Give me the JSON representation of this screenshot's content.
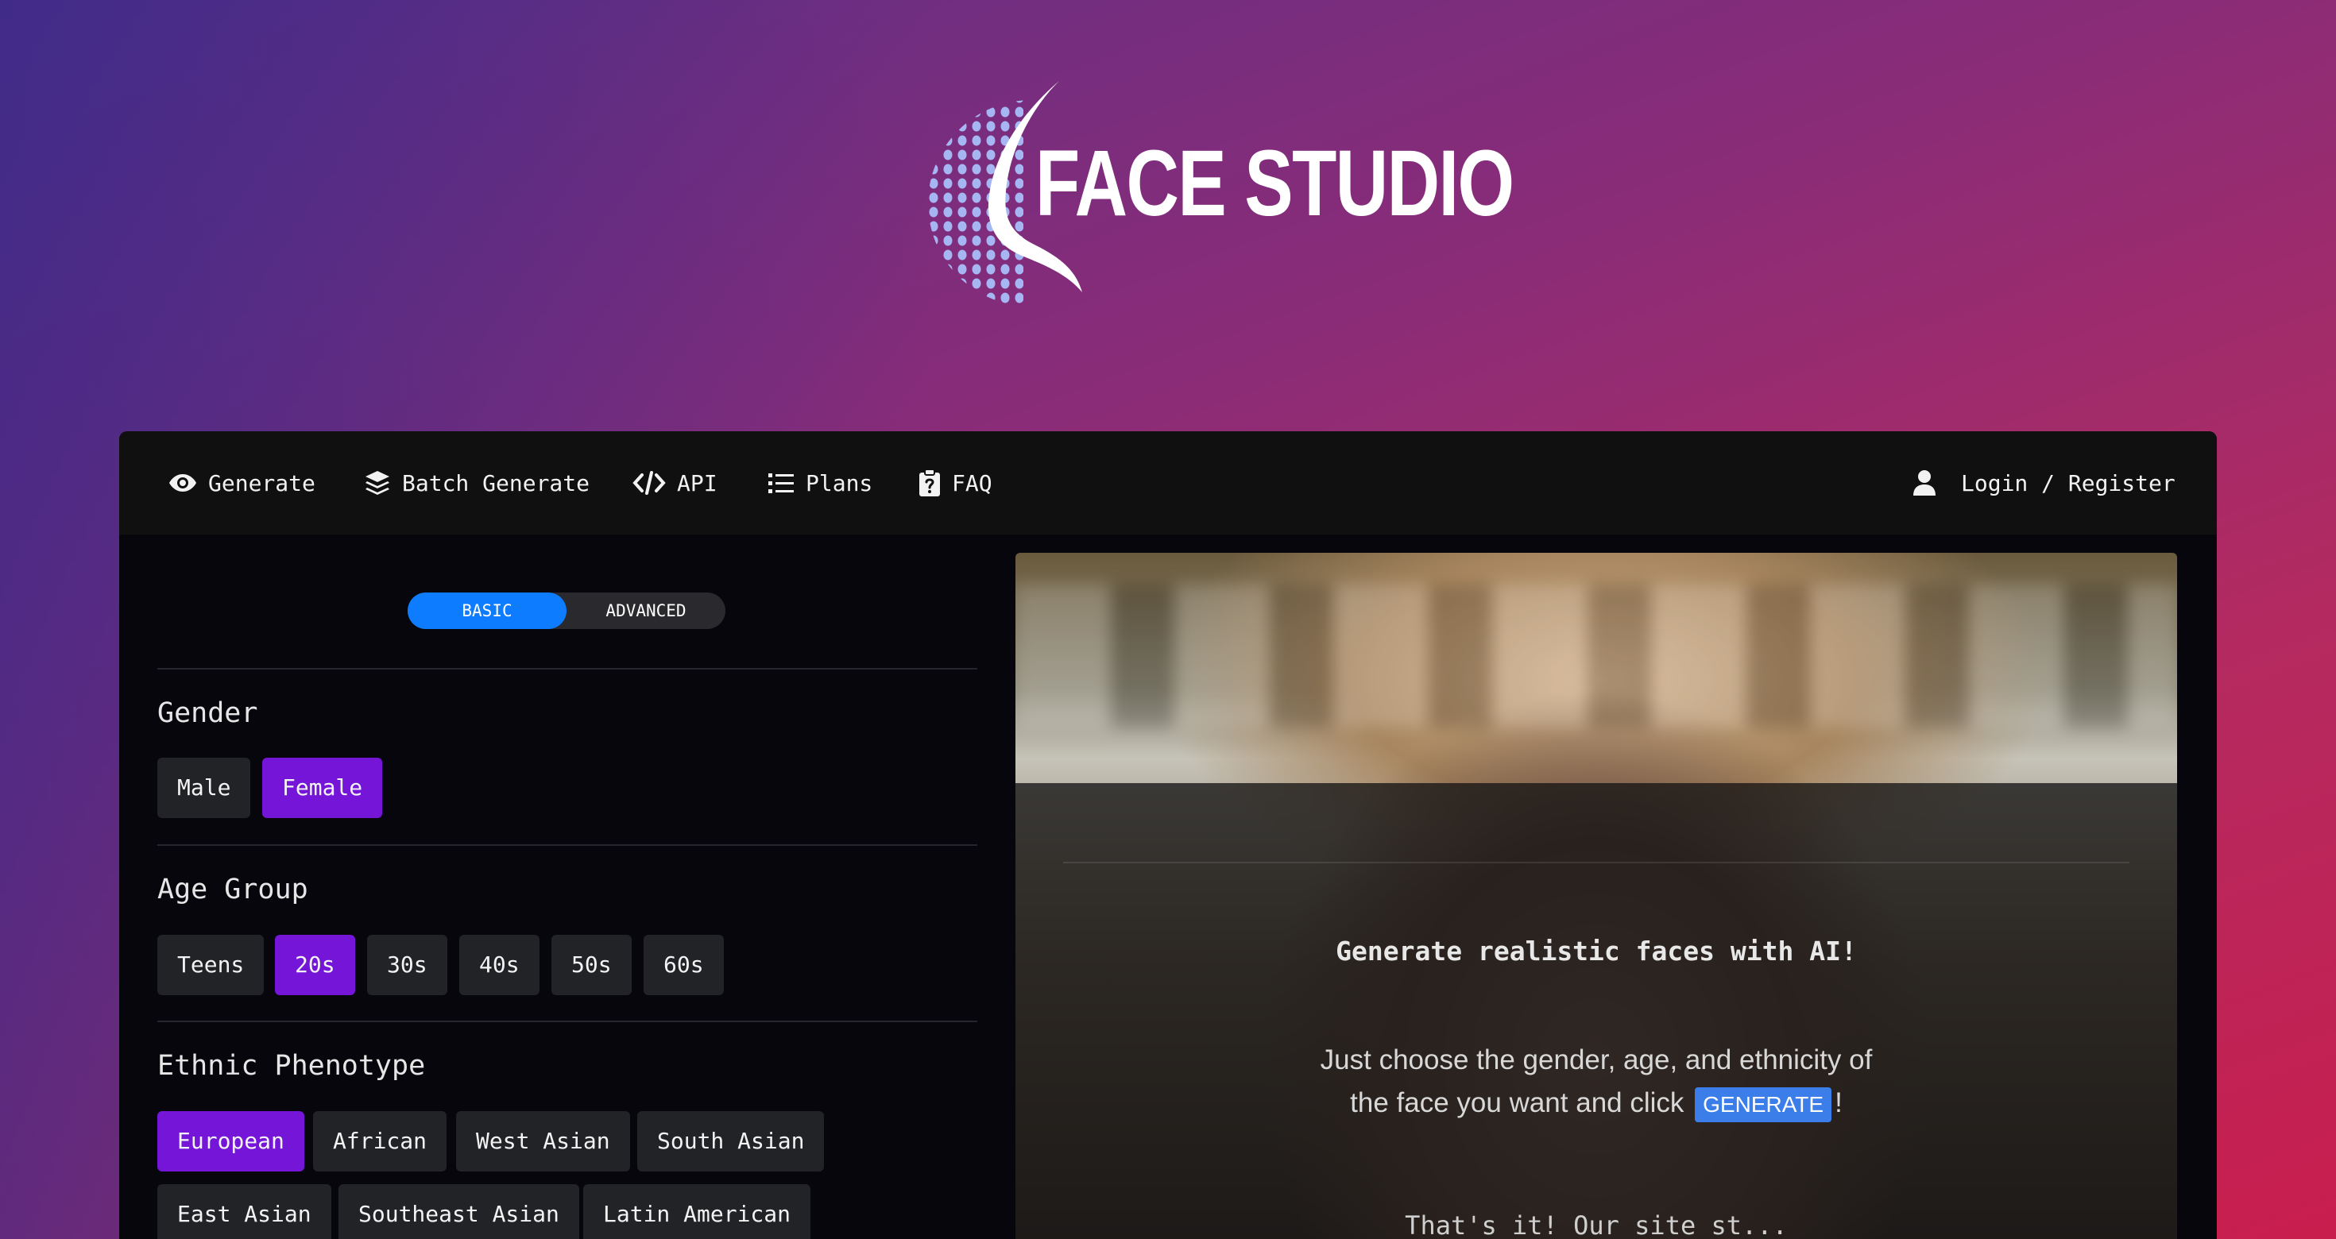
{
  "brand": {
    "name": "FACE STUDIO",
    "accent": "#7515d8",
    "toggle_accent": "#0d7cff"
  },
  "nav": {
    "items": [
      {
        "label": "Generate",
        "icon": "eye-icon"
      },
      {
        "label": "Batch Generate",
        "icon": "layers-icon"
      },
      {
        "label": "API",
        "icon": "code-icon"
      },
      {
        "label": "Plans",
        "icon": "list-icon"
      },
      {
        "label": "FAQ",
        "icon": "clipboard-question-icon"
      }
    ],
    "login": {
      "label": "Login / Register",
      "icon": "user-icon"
    }
  },
  "mode_toggle": {
    "basic": "BASIC",
    "advanced": "ADVANCED",
    "selected": "BASIC"
  },
  "gender": {
    "title": "Gender",
    "options": [
      "Male",
      "Female"
    ],
    "selected": "Female"
  },
  "age": {
    "title": "Age Group",
    "options": [
      "Teens",
      "20s",
      "30s",
      "40s",
      "50s",
      "60s"
    ],
    "selected": "20s"
  },
  "ethnicity": {
    "title": "Ethnic Phenotype",
    "options": [
      "European",
      "African",
      "West Asian",
      "South Asian",
      "East Asian",
      "Southeast Asian",
      "Latin American"
    ],
    "selected": "European"
  },
  "preview": {
    "headline": "Generate realistic faces with AI!",
    "desc_before": "Just choose the gender, age, and ethnicity of the face you want and click",
    "button_label": "GENERATE",
    "desc_after": "!",
    "cut_text": "That's it! Our site st..."
  }
}
